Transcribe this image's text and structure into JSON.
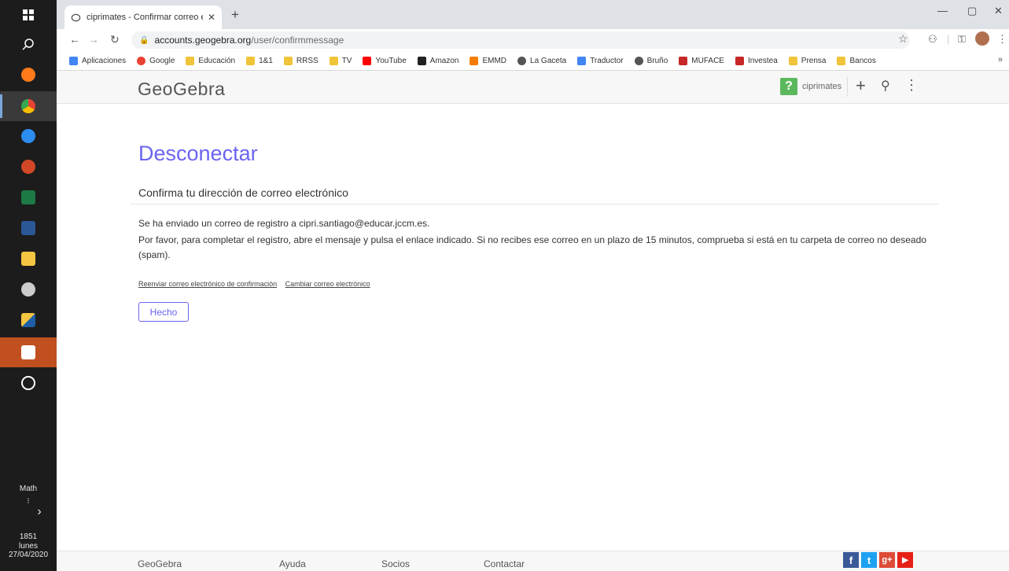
{
  "taskbar": {
    "math_label": "Math",
    "math_sub": "⁝",
    "arrow": "›",
    "time": "1851",
    "day": "lunes",
    "date": "27/04/2020"
  },
  "browser": {
    "tab_title": "ciprimates - Confirmar correo ele",
    "tab_close": "✕",
    "new_tab": "+",
    "url_host": "accounts.geogebra.org",
    "url_path": "/user/confirmmessage",
    "minimize": "—",
    "maximize": "▢",
    "close": "✕",
    "bookmarks": [
      {
        "label": "Aplicaciones",
        "color": "#4285f4"
      },
      {
        "label": "Google",
        "color": "#ea4335"
      },
      {
        "label": "Educación",
        "color": "#f0c43a"
      },
      {
        "label": "1&1",
        "color": "#f0c43a"
      },
      {
        "label": "RRSS",
        "color": "#f0c43a"
      },
      {
        "label": "TV",
        "color": "#f0c43a"
      },
      {
        "label": "YouTube",
        "color": "#ff0000"
      },
      {
        "label": "Amazon",
        "color": "#222222"
      },
      {
        "label": "EMMD",
        "color": "#f57c00"
      },
      {
        "label": "La Gaceta",
        "color": "#555555"
      },
      {
        "label": "Traductor",
        "color": "#4285f4"
      },
      {
        "label": "Bruño",
        "color": "#555555"
      },
      {
        "label": "MUFACE",
        "color": "#c62828"
      },
      {
        "label": "Investea",
        "color": "#c62828"
      },
      {
        "label": "Prensa",
        "color": "#f0c43a"
      },
      {
        "label": "Bancos",
        "color": "#f0c43a"
      }
    ],
    "bookmarks_more": "»"
  },
  "header": {
    "logo": "GeoGebra",
    "help": "?",
    "username": "ciprimates",
    "plus": "+",
    "search": "⚲",
    "more": "⋮"
  },
  "main": {
    "title": "Desconectar",
    "subtitle": "Confirma tu dirección de correo electrónico",
    "message_1": "Se ha enviado un correo de registro a cipri.santiago@educar.jccm.es.",
    "message_2": "Por favor, para completar el registro, abre el mensaje y pulsa el enlace indicado. Si no recibes ese correo en un plazo de 15 minutos, comprueba si está en tu carpeta de correo no deseado (spam).",
    "link_resend": "Reenviar correo electrónico de confirmación",
    "link_change": "Cambiar correo electrónico",
    "done_button": "Hecho"
  },
  "footer": {
    "links": [
      "GeoGebra",
      "Ayuda",
      "Socios",
      "Contactar"
    ],
    "social": {
      "facebook": "f",
      "twitter": "t",
      "google": "g+",
      "youtube": "▶"
    }
  }
}
